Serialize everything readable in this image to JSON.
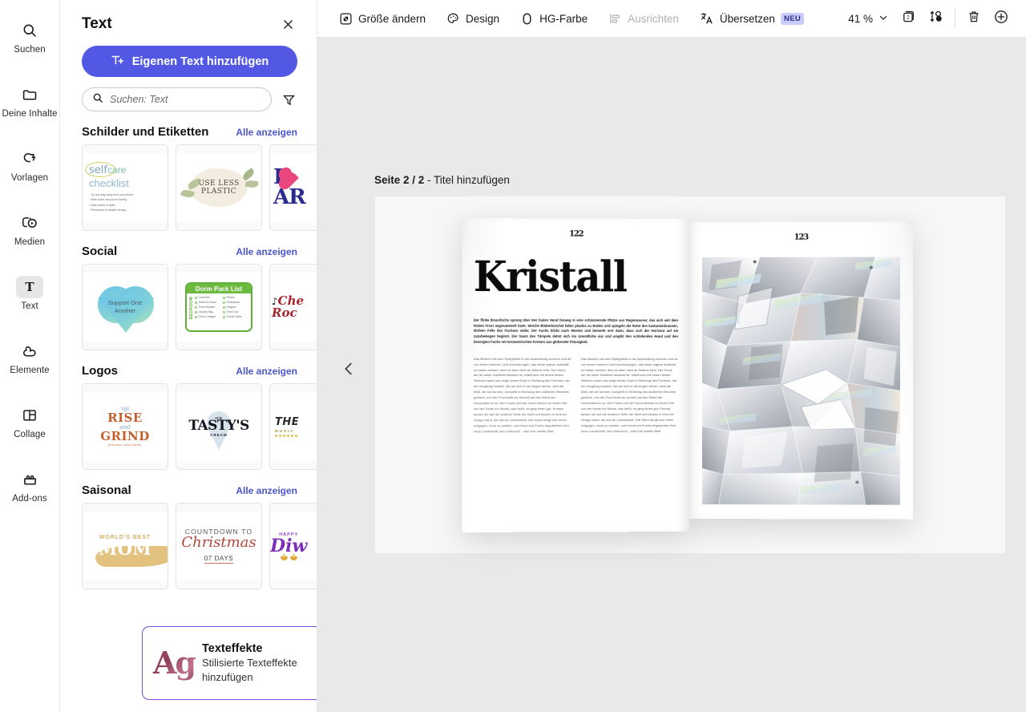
{
  "rail": {
    "items": [
      {
        "label": "Suchen",
        "icon": "search-icon",
        "active": false
      },
      {
        "label": "Deine Inhalte",
        "icon": "folder-icon",
        "active": false
      },
      {
        "label": "Vorlagen",
        "icon": "templates-icon",
        "active": false
      },
      {
        "label": "Medien",
        "icon": "media-icon",
        "active": false
      },
      {
        "label": "Text",
        "icon": "text-t-icon",
        "active": true
      },
      {
        "label": "Elemente",
        "icon": "shapes-icon",
        "active": false
      },
      {
        "label": "Collage",
        "icon": "collage-icon",
        "active": false
      },
      {
        "label": "Add-ons",
        "icon": "addons-icon",
        "active": false
      }
    ]
  },
  "panel": {
    "title": "Text",
    "close_label": "×",
    "add_text_button": "Eigenen Text hinzufügen",
    "search": {
      "placeholder": "Suchen: Text",
      "value": ""
    },
    "filter_label": "Filter",
    "see_all_label": "Alle anzeigen",
    "sections": [
      {
        "title": "Schilder und Etiketten",
        "link": "Alle anzeigen",
        "thumbs": [
          {
            "name": "self-care-checklist",
            "lines": [
              "self",
              "care",
              "checklist"
            ],
            "items": [
              "Try and stay away from your phone",
              "Write down how you're feeling",
              "Drink plenty of water",
              "Remember to breathe deeply"
            ]
          },
          {
            "name": "use-less-plastic",
            "lines": [
              "USE LESS",
              "PLASTIC"
            ]
          },
          {
            "name": "i-love-art",
            "lines": [
              "I",
              "AR"
            ]
          }
        ]
      },
      {
        "title": "Social",
        "link": "Alle anzeigen",
        "thumbs": [
          {
            "name": "support-one-another",
            "lines": [
              "Support One",
              "Another"
            ]
          },
          {
            "name": "dorm-pack-list",
            "header": "Dorm Pack List",
            "vertical": "BEDROOM",
            "items": [
              "Comforter",
              "Pillows",
              "Sheets & Duvet",
              "Pillowcases",
              "Throw Blanket",
              "Hangers",
              "Laundry Bag",
              "Trash Can",
              "Phone Charger",
              "Thumb Tacks"
            ]
          },
          {
            "name": "cheer-rock",
            "lines": [
              "Che",
              "Roc"
            ]
          }
        ]
      },
      {
        "title": "Logos",
        "link": "Alle anzeigen",
        "thumbs": [
          {
            "name": "rise-and-grind",
            "lines": [
              "RISE",
              "and",
              "GRIND",
              "premium roast coffee"
            ]
          },
          {
            "name": "tastys-ice-cream",
            "lines": [
              "ICE",
              "TASTY'S",
              "CREAM"
            ]
          },
          {
            "name": "the-music-logo",
            "lines": [
              "THE",
              "MUSIC"
            ]
          }
        ]
      },
      {
        "title": "Saisonal",
        "link": "Alle anzeigen",
        "thumbs": [
          {
            "name": "worlds-best-mom",
            "lines": [
              "WORLD'S BEST",
              "MOM"
            ]
          },
          {
            "name": "countdown-to-christmas",
            "lines": [
              "COUNTDOWN TO",
              "Christmas",
              "07 DAYS"
            ]
          },
          {
            "name": "happy-diwali",
            "lines": [
              "HAPPY",
              "Diw"
            ]
          }
        ]
      }
    ]
  },
  "promo": {
    "art": "Ag",
    "title": "Texteffekte",
    "subtitle": "Stilisierte Texteffekte hinzufügen",
    "close_label": "×"
  },
  "toolbar": {
    "items": [
      {
        "label": "Größe ändern",
        "icon": "resize-icon",
        "disabled": false
      },
      {
        "label": "Design",
        "icon": "palette-icon",
        "disabled": false
      },
      {
        "label": "HG-Farbe",
        "icon": "background-color-icon",
        "disabled": false
      },
      {
        "label": "Ausrichten",
        "icon": "align-icon",
        "disabled": true
      },
      {
        "label": "Übersetzen",
        "icon": "translate-icon",
        "disabled": false,
        "badge": "NEU"
      }
    ],
    "zoom": {
      "value": "41 %",
      "chevron": "chevron-down-icon"
    },
    "pages_icon": "pages-icon",
    "pages_count": "2",
    "reorder_icon": "reorder-pages-icon",
    "delete_icon": "trash-icon",
    "add_icon": "add-page-icon"
  },
  "canvas": {
    "page_label_bold": "Seite 2 / 2",
    "page_label_rest": " - Titel hinzufügen",
    "prev_icon": "chevron-left-icon",
    "spread": {
      "left_page": {
        "folio": "122",
        "headline": "Kristall",
        "lede": "Der flinke Braunfuchs sprang über den faulen Hund hinweg in eine schimmernde Pfütze aus Regenwasser, das sich seit dem letzten Frost angesammelt hatte. Weiche Blätterbüschel fallen planlos zu Boden und spiegeln die Ruhe des kastanienbraunen, dichten Fells des Fuchses wider. Der Fuchs blickt nach Westen und bemerkt erst dann, dass sich der Horizont auf sie zuzubewegen beginnt. Der Saum des Tümpels dehnt sich ins Unendliche aus und umgibt den schlafenden Hund und den besorgten Fuchs mit konzentrischen Kreisen aus glühender Flüssigkeit.",
        "column_1": "Das Becken hat sein Spiegelbild in der Ausbreitung verloren und ist von einem inneren Licht durchdrungen, das seine eigene Autorität zu haben scheint, dem es aber nicht an Wärme fehlt. Der Hund, der für seine Sanftheit bekannt ist, rüttelt sich mit einem leisen Stöhnen wach und neigt seinen Kopf in Richtung des Fuchses, der ihn neugierig mustert. Als sie sich in die Augen sehen, wird die Welt, die sie kennen, komplett in Richtung des südlichen Himmels gedreht, und der Pool treibt sie schnell auf den Rand der Horizontkurve zu. Der Fuchs und der Hund stürzen im freien Fall von der Kante ins Nichts, das heißt, es ging ihnen gut. Prompt landen sie auf der anderen Seite der Welt und blicken in eine Art riesige Hand, die auf sie zurückblickt. Die Hand beugt sich ihnen entgegen, ohne zu winken, und Hund und Fuchs begutachten ihre neue Landschaft, den Unterpool - oder ihre zweite Welt.",
        "column_2": "Das Becken hat sein Spiegelbild in der Ausbreitung verloren und ist von einem inneren Licht durchdrungen, das seine eigene Autorität zu haben scheint, dem es aber nicht an Wärme fehlt. Der Hund, der für seine Sanftheit bekannt ist, rüttelt sich mit einem leisen Stöhnen wach und neigt seinen Kopf in Richtung des Fuchses, der ihn neugierig mustert. Als sie sich in die Augen sehen, wird die Welt, die sie kennen, komplett in Richtung des südlichen Himmels gedreht, und der Pool treibt sie schnell auf den Rand der Horizontkurve zu. Der Fuchs und der Hund stürzen im freien Fall von der Kante ins Nichts, das heißt, es ging ihnen gut. Prompt landen sie auf der anderen Seite der Welt und blicken in eine Art riesige Hand, die auf sie zurückblickt. Die Hand beugt sich ihnen entgegen, ohne zu winken, und Hund und Fuchs begutachten ihre neue Landschaft, den Unterpool - oder ihre zweite Welt."
      },
      "right_page": {
        "folio": "123",
        "image_name": "crystal-facets-photo"
      }
    }
  },
  "colors": {
    "accent": "#5258e4",
    "link": "#4b54cc",
    "promo_border": "#7c4ddb",
    "badge_bg": "#c9cdfa",
    "canvas_bg": "#e9e9e9"
  }
}
